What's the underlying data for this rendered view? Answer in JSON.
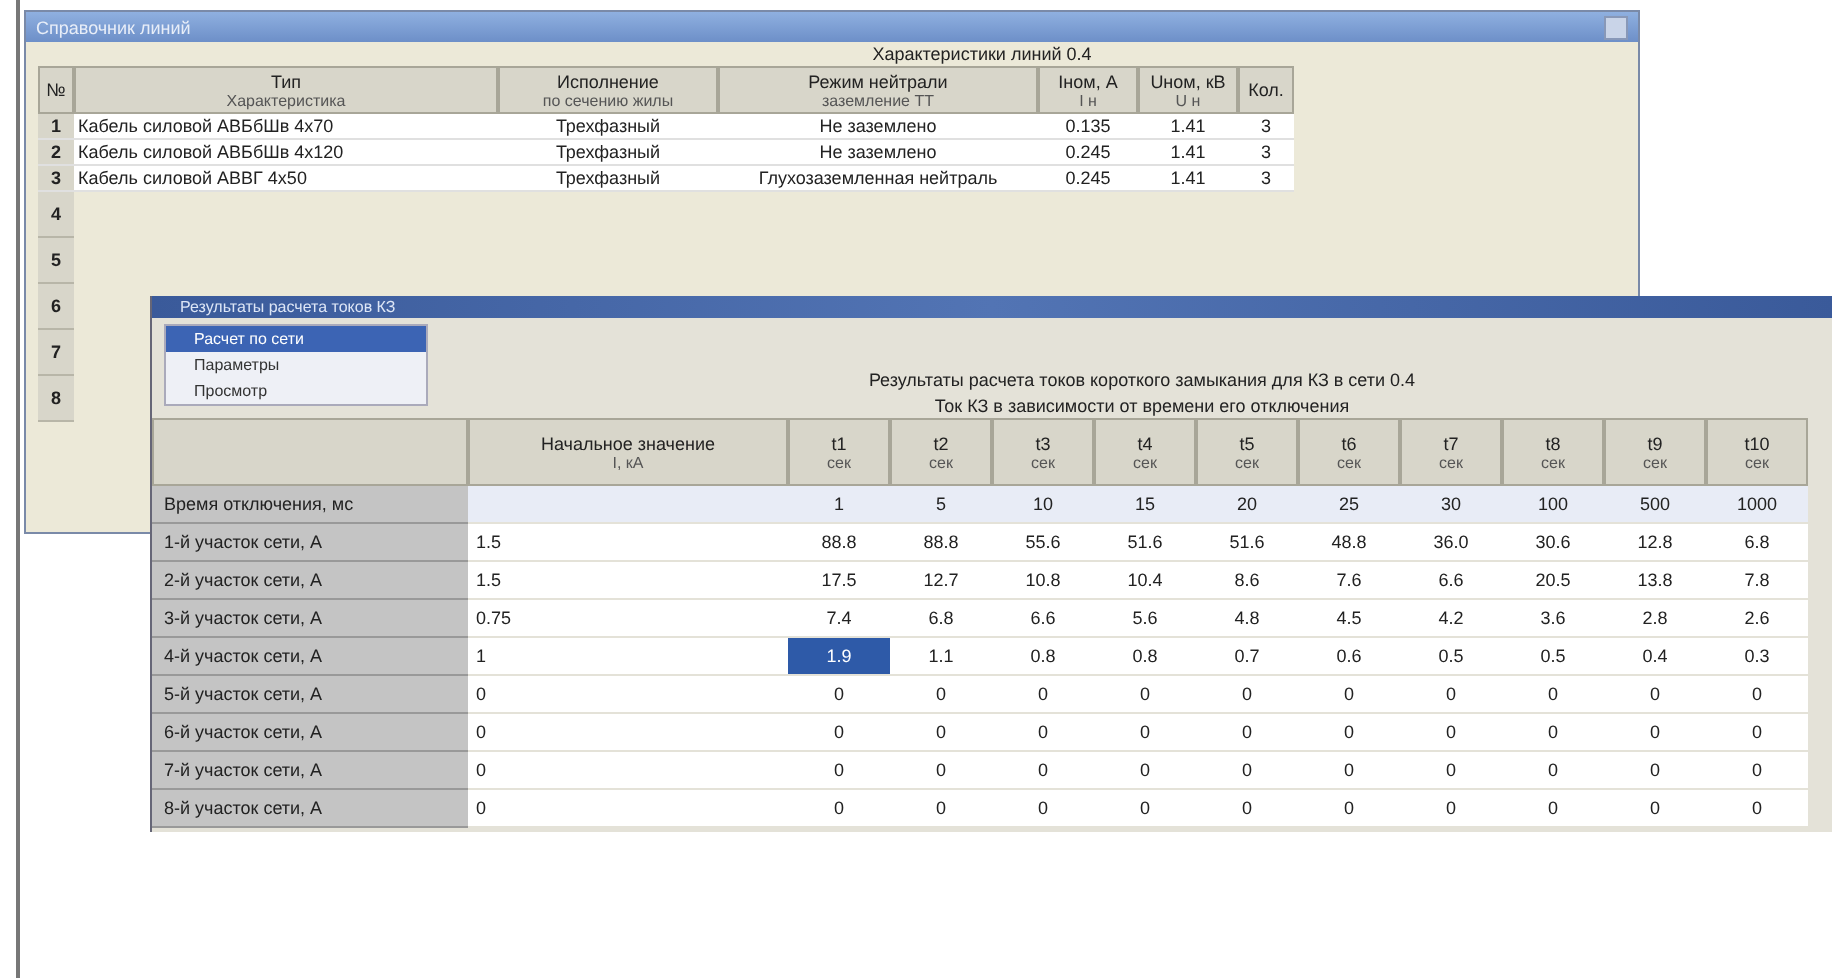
{
  "back_window": {
    "title": "Справочник линий",
    "caption": "Характеристики линий 0.4",
    "columns": [
      {
        "top": "№"
      },
      {
        "top": "Тип",
        "bottom": "Характеристика"
      },
      {
        "top": "Исполнение",
        "bottom": "по сечению жилы"
      },
      {
        "top": "Режим нейтрали",
        "bottom": "заземление ТТ"
      },
      {
        "top": "Iном, А",
        "bottom": "I н"
      },
      {
        "top": "Uном, кВ",
        "bottom": "U н"
      },
      {
        "top": "Кол."
      }
    ],
    "rows": [
      {
        "cells": [
          "1",
          "Кабель силовой АВБбШв 4х70",
          "Трехфазный",
          "Не заземлено",
          "0.135",
          "1.41",
          "3"
        ]
      },
      {
        "cells": [
          "2",
          "Кабель силовой АВБбШв 4х120",
          "Трехфазный",
          "Не заземлено",
          "0.245",
          "1.41",
          "3"
        ]
      },
      {
        "cells": [
          "3",
          "Кабель силовой АВВГ 4х50",
          "Трехфазный",
          "Глухозаземленная нейтраль",
          "0.245",
          "1.41",
          "3"
        ]
      }
    ],
    "more_row_numbers": [
      "4",
      "5",
      "6",
      "7",
      "8"
    ]
  },
  "front_window": {
    "title": "Результаты расчета токов КЗ",
    "menu": [
      {
        "label": "Расчет по сети",
        "selected": true
      },
      {
        "label": "Параметры",
        "selected": false
      },
      {
        "label": "Просмотр",
        "selected": false
      }
    ],
    "caption": "Результаты расчета токов короткого замыкания для КЗ в сети 0.4",
    "subcaption": "Ток КЗ в зависимости от времени его отключения",
    "first_column": {
      "top": "Начальное значение",
      "bottom": "I, кА"
    },
    "columns": [
      {
        "top": "t1",
        "bottom": "сек"
      },
      {
        "top": "t2",
        "bottom": "сек"
      },
      {
        "top": "t3",
        "bottom": "сек"
      },
      {
        "top": "t4",
        "bottom": "сек"
      },
      {
        "top": "t5",
        "bottom": "сек"
      },
      {
        "top": "t6",
        "bottom": "сек"
      },
      {
        "top": "t7",
        "bottom": "сек"
      },
      {
        "top": "t8",
        "bottom": "сек"
      },
      {
        "top": "t9",
        "bottom": "сек"
      },
      {
        "top": "t10",
        "bottom": "сек"
      }
    ],
    "rows": [
      {
        "kind": "time",
        "label": "Время отключения, мс",
        "initial": "",
        "cells": [
          {
            "v": "1",
            "selected": false
          },
          {
            "v": "5",
            "selected": false
          },
          {
            "v": "10",
            "selected": false
          },
          {
            "v": "15",
            "selected": false
          },
          {
            "v": "20",
            "selected": false
          },
          {
            "v": "25",
            "selected": false
          },
          {
            "v": "30",
            "selected": false
          },
          {
            "v": "100",
            "selected": false
          },
          {
            "v": "500",
            "selected": false
          },
          {
            "v": "1000",
            "selected": false
          }
        ]
      },
      {
        "kind": "data",
        "label": "1-й участок сети, А",
        "initial": "1.5",
        "cells": [
          {
            "v": "88.8",
            "selected": false
          },
          {
            "v": "88.8",
            "selected": false
          },
          {
            "v": "55.6",
            "selected": false
          },
          {
            "v": "51.6",
            "selected": false
          },
          {
            "v": "51.6",
            "selected": false
          },
          {
            "v": "48.8",
            "selected": false
          },
          {
            "v": "36.0",
            "selected": false
          },
          {
            "v": "30.6",
            "selected": false
          },
          {
            "v": "12.8",
            "selected": false
          },
          {
            "v": "6.8",
            "selected": false
          }
        ]
      },
      {
        "kind": "data",
        "label": "2-й участок сети, А",
        "initial": "1.5",
        "cells": [
          {
            "v": "17.5",
            "selected": false
          },
          {
            "v": "12.7",
            "selected": false
          },
          {
            "v": "10.8",
            "selected": false
          },
          {
            "v": "10.4",
            "selected": false
          },
          {
            "v": "8.6",
            "selected": false
          },
          {
            "v": "7.6",
            "selected": false
          },
          {
            "v": "6.6",
            "selected": false
          },
          {
            "v": "20.5",
            "selected": false
          },
          {
            "v": "13.8",
            "selected": false
          },
          {
            "v": "7.8",
            "selected": false
          }
        ]
      },
      {
        "kind": "data",
        "label": "3-й участок сети, А",
        "initial": "0.75",
        "cells": [
          {
            "v": "7.4",
            "selected": false
          },
          {
            "v": "6.8",
            "selected": false
          },
          {
            "v": "6.6",
            "selected": false
          },
          {
            "v": "5.6",
            "selected": false
          },
          {
            "v": "4.8",
            "selected": false
          },
          {
            "v": "4.5",
            "selected": false
          },
          {
            "v": "4.2",
            "selected": false
          },
          {
            "v": "3.6",
            "selected": false
          },
          {
            "v": "2.8",
            "selected": false
          },
          {
            "v": "2.6",
            "selected": false
          }
        ]
      },
      {
        "kind": "data",
        "label": "4-й участок сети, А",
        "initial": "1",
        "cells": [
          {
            "v": "1.9",
            "selected": true
          },
          {
            "v": "1.1",
            "selected": false
          },
          {
            "v": "0.8",
            "selected": false
          },
          {
            "v": "0.8",
            "selected": false
          },
          {
            "v": "0.7",
            "selected": false
          },
          {
            "v": "0.6",
            "selected": false
          },
          {
            "v": "0.5",
            "selected": false
          },
          {
            "v": "0.5",
            "selected": false
          },
          {
            "v": "0.4",
            "selected": false
          },
          {
            "v": "0.3",
            "selected": false
          }
        ]
      },
      {
        "kind": "data",
        "label": "5-й участок сети, А",
        "initial": "0",
        "cells": [
          {
            "v": "0",
            "selected": false
          },
          {
            "v": "0",
            "selected": false
          },
          {
            "v": "0",
            "selected": false
          },
          {
            "v": "0",
            "selected": false
          },
          {
            "v": "0",
            "selected": false
          },
          {
            "v": "0",
            "selected": false
          },
          {
            "v": "0",
            "selected": false
          },
          {
            "v": "0",
            "selected": false
          },
          {
            "v": "0",
            "selected": false
          },
          {
            "v": "0",
            "selected": false
          }
        ]
      },
      {
        "kind": "data",
        "label": "6-й участок сети, А",
        "initial": "0",
        "cells": [
          {
            "v": "0",
            "selected": false
          },
          {
            "v": "0",
            "selected": false
          },
          {
            "v": "0",
            "selected": false
          },
          {
            "v": "0",
            "selected": false
          },
          {
            "v": "0",
            "selected": false
          },
          {
            "v": "0",
            "selected": false
          },
          {
            "v": "0",
            "selected": false
          },
          {
            "v": "0",
            "selected": false
          },
          {
            "v": "0",
            "selected": false
          },
          {
            "v": "0",
            "selected": false
          }
        ]
      },
      {
        "kind": "data",
        "label": "7-й участок сети, А",
        "initial": "0",
        "cells": [
          {
            "v": "0",
            "selected": false
          },
          {
            "v": "0",
            "selected": false
          },
          {
            "v": "0",
            "selected": false
          },
          {
            "v": "0",
            "selected": false
          },
          {
            "v": "0",
            "selected": false
          },
          {
            "v": "0",
            "selected": false
          },
          {
            "v": "0",
            "selected": false
          },
          {
            "v": "0",
            "selected": false
          },
          {
            "v": "0",
            "selected": false
          },
          {
            "v": "0",
            "selected": false
          }
        ]
      },
      {
        "kind": "data",
        "label": "8-й участок сети, А",
        "initial": "0",
        "cells": [
          {
            "v": "0",
            "selected": false
          },
          {
            "v": "0",
            "selected": false
          },
          {
            "v": "0",
            "selected": false
          },
          {
            "v": "0",
            "selected": false
          },
          {
            "v": "0",
            "selected": false
          },
          {
            "v": "0",
            "selected": false
          },
          {
            "v": "0",
            "selected": false
          },
          {
            "v": "0",
            "selected": false
          },
          {
            "v": "0",
            "selected": false
          },
          {
            "v": "0",
            "selected": false
          }
        ]
      }
    ]
  }
}
